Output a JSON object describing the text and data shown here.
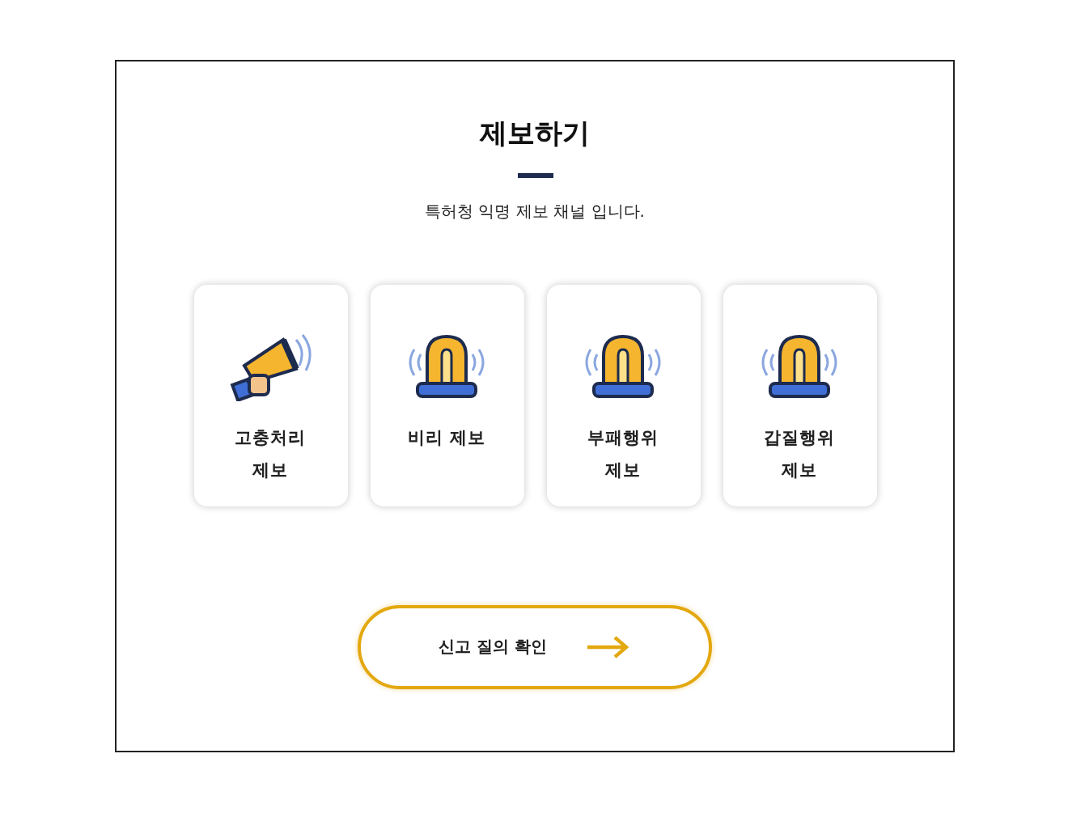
{
  "title": "제보하기",
  "subtitle": "특허청 익명 제보 채널 입니다.",
  "cards": [
    {
      "kind": "megaphone",
      "label": "고충처리 제보"
    },
    {
      "kind": "siren",
      "label": "비리 제보"
    },
    {
      "kind": "siren",
      "label": "부패행위 제보"
    },
    {
      "kind": "siren",
      "label": "갑질행위 제보"
    }
  ],
  "button": {
    "label": "신고 질의 확인"
  }
}
